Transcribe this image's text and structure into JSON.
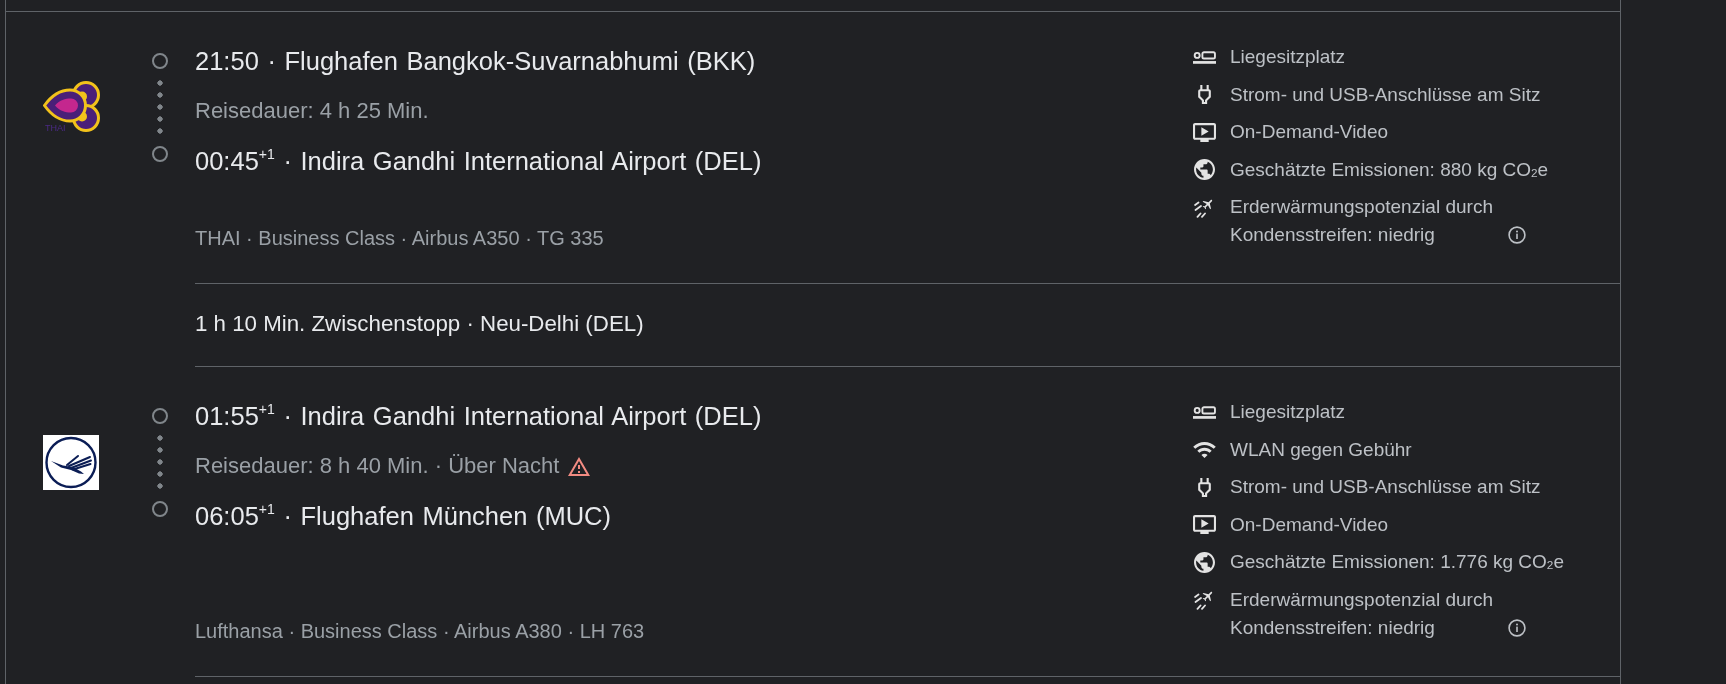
{
  "itinerary": [
    {
      "kind": "leg",
      "logo_text": "THAI",
      "departure": "21:50 · Flughafen Bangkok-Suvarnabhumi (BKK)",
      "duration": "Reisedauer: 4 h 25 Min.",
      "warning": false,
      "arrival": "00:45$^{+1}$ · Indira Gandhi International Airport (DEL)",
      "details": "THAI · Business Class · Airbus A350 · TG 335",
      "amenities": [
        {
          "kind": "seat",
          "text": "Liegesitzplatz"
        },
        {
          "kind": "power",
          "text": "Strom- und USB-Anschlüsse am Sitz"
        },
        {
          "kind": "video",
          "text": "On-Demand-Video"
        },
        {
          "kind": "emissions",
          "text": "Geschätzte Emissionen: 880 kg CO$_{2}$e"
        },
        {
          "kind": "contrails",
          "text": "Erderwärmungspotenzial durch Kondensstreifen: niedrig"
        }
      ]
    },
    {
      "kind": "layover",
      "text": "1 h 10 Min. Zwischenstopp · Neu-Delhi (DEL)"
    },
    {
      "kind": "leg",
      "departure": "01:55$^{+1}$ · Indira Gandhi International Airport (DEL)",
      "duration": "Reisedauer: 8 h 40 Min. · Über Nacht",
      "warning": true,
      "arrival": "06:05$^{+1}$ · Flughafen München (MUC)",
      "details": "Lufthansa · Business Class · Airbus A380 · LH 763",
      "amenities": [
        {
          "kind": "seat",
          "text": "Liegesitzplatz"
        },
        {
          "kind": "wifi",
          "text": "WLAN gegen Gebühr"
        },
        {
          "kind": "power",
          "text": "Strom- und USB-Anschlüsse am Sitz"
        },
        {
          "kind": "video",
          "text": "On-Demand-Video"
        },
        {
          "kind": "emissions",
          "text": "Geschätzte Emissionen: 1.776 kg CO$_{2}$e"
        },
        {
          "kind": "contrails",
          "text": "Erderwärmungspotenzial durch Kondensstreifen: niedrig"
        }
      ]
    }
  ]
}
